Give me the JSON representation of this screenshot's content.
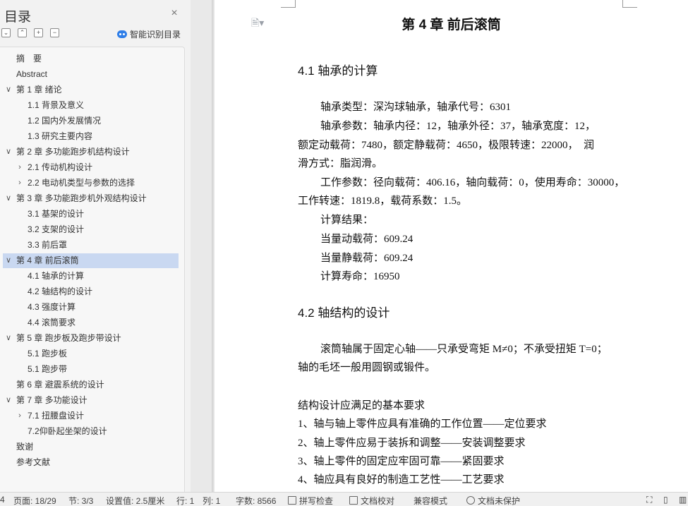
{
  "nav": {
    "title": "目录",
    "smart_label": "智能识别目录",
    "toc": [
      {
        "label": "摘　要",
        "level": 0,
        "arrow": ""
      },
      {
        "label": "Abstract",
        "level": 0,
        "arrow": ""
      },
      {
        "label": "第 1 章  绪论",
        "level": 0,
        "arrow": "∨"
      },
      {
        "label": "1.1 背景及意义",
        "level": 1,
        "arrow": ""
      },
      {
        "label": "1.2 国内外发展情况",
        "level": 1,
        "arrow": ""
      },
      {
        "label": "1.3 研究主要内容",
        "level": 1,
        "arrow": ""
      },
      {
        "label": "第 2 章  多功能跑步机结构设计",
        "level": 0,
        "arrow": "∨"
      },
      {
        "label": "2.1  传动机构设计",
        "level": 1,
        "arrow": "›"
      },
      {
        "label": "2.2  电动机类型与参数的选择",
        "level": 1,
        "arrow": "›"
      },
      {
        "label": "第 3 章  多功能跑步机外观结构设计",
        "level": 0,
        "arrow": "∨"
      },
      {
        "label": "3.1 基架的设计",
        "level": 1,
        "arrow": ""
      },
      {
        "label": "3.2 支架的设计",
        "level": 1,
        "arrow": ""
      },
      {
        "label": "3.3 前后罩",
        "level": 1,
        "arrow": ""
      },
      {
        "label": "第 4 章  前后滚筒",
        "level": 0,
        "arrow": "∨",
        "selected": true
      },
      {
        "label": "4.1 轴承的计算",
        "level": 1,
        "arrow": ""
      },
      {
        "label": "4.2 轴结构的设计",
        "level": 1,
        "arrow": ""
      },
      {
        "label": "4.3 强度计算",
        "level": 1,
        "arrow": ""
      },
      {
        "label": "4.4 滚筒要求",
        "level": 1,
        "arrow": ""
      },
      {
        "label": "第 5 章  跑步板及跑步带设计",
        "level": 0,
        "arrow": "∨"
      },
      {
        "label": "5.1 跑步板",
        "level": 1,
        "arrow": ""
      },
      {
        "label": "5.1 跑步带",
        "level": 1,
        "arrow": ""
      },
      {
        "label": "第 6 章  避震系统的设计",
        "level": 0,
        "arrow": ""
      },
      {
        "label": "第 7 章  多功能设计",
        "level": 0,
        "arrow": "∨"
      },
      {
        "label": "7.1 扭腰盘设计",
        "level": 1,
        "arrow": "›"
      },
      {
        "label": "7.2仰卧起坐架的设计",
        "level": 1,
        "arrow": ""
      },
      {
        "label": "致谢",
        "level": 0,
        "arrow": ""
      },
      {
        "label": "参考文献",
        "level": 0,
        "arrow": ""
      }
    ]
  },
  "doc": {
    "chapter_title": "第 4 章  前后滚筒",
    "s41_title": "4.1 轴承的计算",
    "s41_lines": [
      "轴承类型：深沟球轴承，轴承代号：6301",
      "轴承参数：轴承内径：12，轴承外径：37，轴承宽度：12，",
      "额定动载荷：7480，额定静载荷：4650，极限转速：22000，　润",
      "滑方式：脂润滑。",
      "工作参数：径向载荷：406.16，轴向载荷：0，使用寿命：30000，",
      "工作转速：1819.8，载荷系数：1.5。",
      "计算结果：",
      "当量动载荷：609.24",
      "当量静载荷：609.24",
      "计算寿命：16950"
    ],
    "s42_title": "4.2 轴结构的设计",
    "s42_lines": [
      "滚筒轴属于固定心轴——只承受弯矩 M≠0；不承受扭矩 T=0；",
      "轴的毛坯一般用圆钢或锻件。",
      "结构设计应满足的基本要求",
      "1、轴与轴上零件应具有准确的工作位置——定位要求",
      "2、轴上零件应易于装拆和调整——安装调整要求",
      "3、轴上零件的固定应牢固可靠——紧固要求",
      "4、轴应具有良好的制造工艺性——工艺要求"
    ]
  },
  "status": {
    "page_num": "4",
    "page": "页面: 18/29",
    "section": "节: 3/3",
    "setting": "设置值: 2.5厘米",
    "row": "行: 1",
    "col": "列: 1",
    "words": "字数: 8566",
    "spell": "拼写检查",
    "proof": "文档校对",
    "compat": "兼容模式",
    "protect": "文档未保护"
  }
}
